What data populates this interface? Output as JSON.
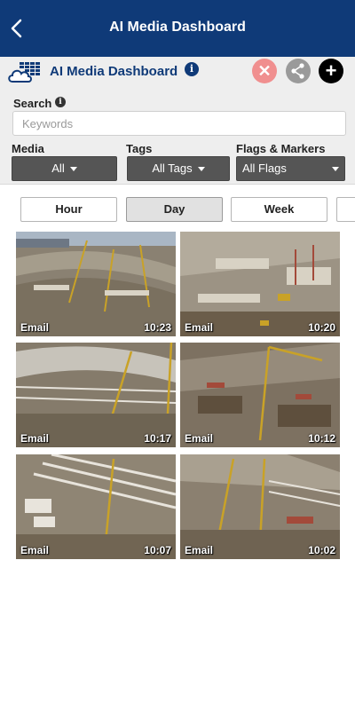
{
  "topbar": {
    "title": "AI Media Dashboard",
    "back_icon": "chevron-left-icon"
  },
  "header": {
    "title": "AI Media Dashboard",
    "info_glyph": "i"
  },
  "actions": {
    "close_glyph": "✕",
    "share_icon": "share-icon",
    "add_glyph": "+"
  },
  "search": {
    "label": "Search",
    "placeholder": "Keywords",
    "value": ""
  },
  "filters": {
    "media": {
      "label": "Media",
      "value": "All"
    },
    "tags": {
      "label": "Tags",
      "value": "All Tags"
    },
    "flags": {
      "label": "Flags & Markers",
      "value": "All Flags"
    }
  },
  "tabs": [
    {
      "label": "Hour",
      "active": false
    },
    {
      "label": "Day",
      "active": true
    },
    {
      "label": "Week",
      "active": false
    }
  ],
  "thumbnails": [
    {
      "label": "Email",
      "time": "10:23"
    },
    {
      "label": "Email",
      "time": "10:20"
    },
    {
      "label": "Email",
      "time": "10:17"
    },
    {
      "label": "Email",
      "time": "10:12"
    },
    {
      "label": "Email",
      "time": "10:07"
    },
    {
      "label": "Email",
      "time": "10:02"
    }
  ],
  "colors": {
    "brand": "#0f3a78",
    "panel": "#eeeeee",
    "dropdown": "#555555",
    "close": "#f08f8f"
  }
}
